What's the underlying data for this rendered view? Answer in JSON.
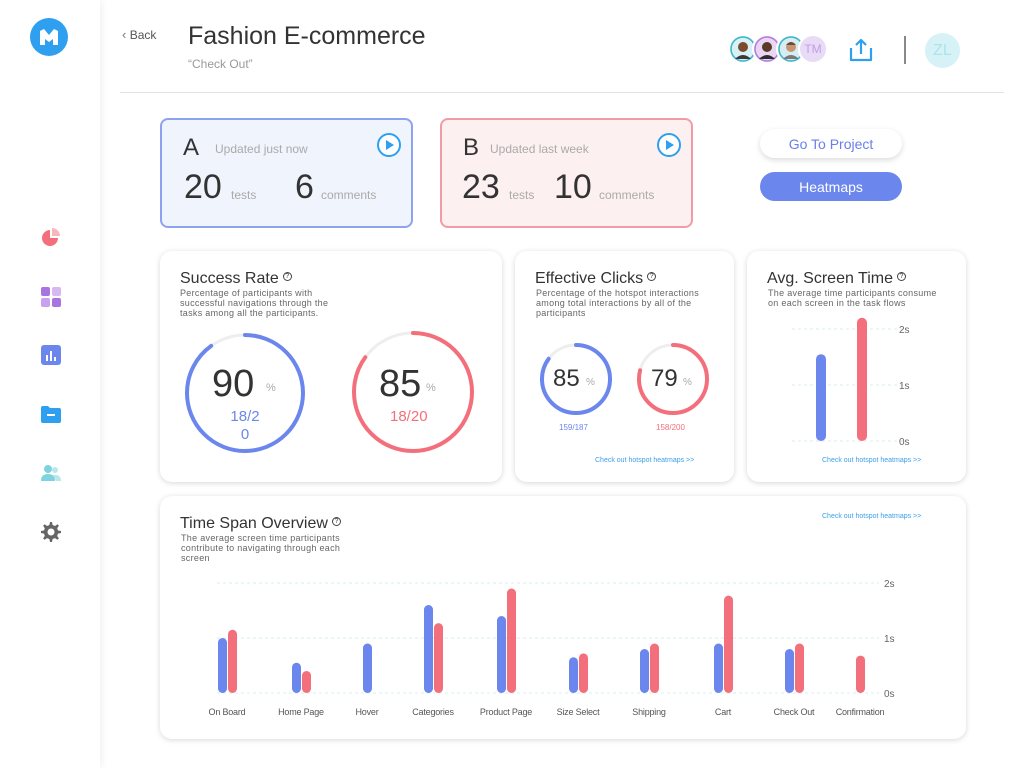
{
  "header": {
    "back_label": "Back",
    "title": "Fashion E-commerce",
    "subtitle": "“Check Out”",
    "collaborator_initials": "TM",
    "user_initials": "ZL"
  },
  "versions": [
    {
      "letter": "A",
      "updated": "Updated just now",
      "tests": "20",
      "tests_label": "tests",
      "comments": "6",
      "comments_label": "comments"
    },
    {
      "letter": "B",
      "updated": "Updated last week",
      "tests": "23",
      "tests_label": "tests",
      "comments": "10",
      "comments_label": "comments"
    }
  ],
  "actions": {
    "go_to_project": "Go To Project",
    "heatmaps": "Heatmaps"
  },
  "success_rate": {
    "title": "Success Rate",
    "desc": "Percentage of participants with successful navigations through the tasks among all the participants.",
    "a": {
      "value": "90",
      "pct": "%",
      "fraction": "18/20",
      "ratio": 0.9
    },
    "b": {
      "value": "85",
      "pct": "%",
      "fraction": "18/20",
      "ratio": 0.85
    }
  },
  "effective_clicks": {
    "title": "Effective Clicks",
    "desc": "Percentage of the hotspot interactions among total interactions by all of the participants",
    "a": {
      "value": "85",
      "pct": "%",
      "fraction": "159/187",
      "ratio": 0.85
    },
    "b": {
      "value": "79",
      "pct": "%",
      "fraction": "158/200",
      "ratio": 0.79
    },
    "link": "Check out hotspot heatmaps >>"
  },
  "avg_screen_time": {
    "title": "Avg. Screen Time",
    "desc": "The average time participants consume on each screen in the task flows",
    "link": "Check out hotspot heatmaps >>"
  },
  "time_span": {
    "title": "Time Span Overview",
    "desc": "The average screen time participants contribute to navigating through each screen",
    "link": "Check out hotspot heatmaps >>"
  },
  "colors": {
    "a": "#6b86ec",
    "b": "#f46f7c",
    "accent": "#2f9ff0"
  },
  "chart_data": [
    {
      "type": "bar",
      "title": "Avg. Screen Time",
      "categories": [
        "A",
        "B"
      ],
      "values": [
        1.55,
        2.2
      ],
      "yticks": [
        "0s",
        "1s",
        "2s"
      ],
      "ylim": [
        0,
        2.2
      ]
    },
    {
      "type": "bar",
      "title": "Time Span Overview",
      "categories": [
        "On Board",
        "Home Page",
        "Hover",
        "Categories",
        "Product Page",
        "Size Select",
        "Shipping",
        "Cart",
        "Check Out",
        "Confirmation"
      ],
      "series": [
        {
          "values": [
            1.0,
            0.55,
            0.9,
            1.6,
            1.4,
            0.65,
            0.8,
            0.9,
            0.8,
            0
          ]
        },
        {
          "values": [
            1.15,
            0.4,
            0,
            1.27,
            1.9,
            0.72,
            0.9,
            1.77,
            0.9,
            0.68
          ]
        }
      ],
      "yticks": [
        "0s",
        "1s",
        "2s"
      ],
      "ylim": [
        0,
        2.0
      ]
    }
  ]
}
